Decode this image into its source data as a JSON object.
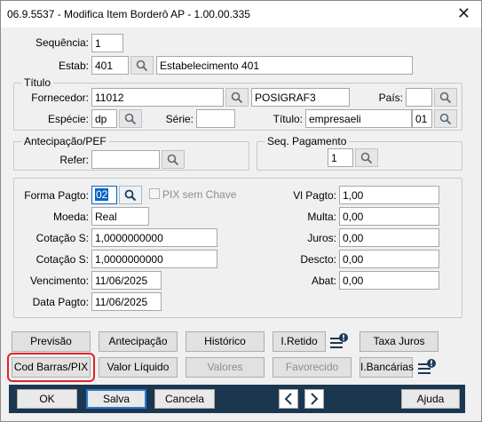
{
  "window": {
    "title": "06.9.5537 - Modifica Item Borderô AP - 1.00.00.335"
  },
  "header": {
    "sequencia_label": "Sequência:",
    "sequencia_value": "1",
    "estab_label": "Estab:",
    "estab_value": "401",
    "estab_desc": "Estabelecimento 401"
  },
  "titulo": {
    "group_label": "Título",
    "fornecedor_label": "Fornecedor:",
    "fornecedor_value": "11012",
    "fornecedor_name": "POSIGRAF3",
    "pais_label": "País:",
    "pais_value": "",
    "especie_label": "Espécie:",
    "especie_value": "dp",
    "serie_label": "Série:",
    "serie_value": "",
    "titulo_label": "Título:",
    "titulo_value": "empresaeli",
    "parcela_value": "01"
  },
  "antecipacao": {
    "group_label": "Antecipação/PEF",
    "refer_label": "Refer:",
    "refer_value": ""
  },
  "seq_pagamento": {
    "group_label": "Seq. Pagamento",
    "value": "1"
  },
  "pagamento": {
    "forma_pagto_label": "Forma Pagto:",
    "forma_pagto_value": "02",
    "pix_label": "PIX sem Chave",
    "moeda_label": "Moeda:",
    "moeda_value": "Real",
    "cotacao1_label": "Cotação S:",
    "cotacao1_value": "1,0000000000",
    "cotacao2_label": "Cotação S:",
    "cotacao2_value": "1,0000000000",
    "vencimento_label": "Vencimento:",
    "vencimento_value": "11/06/2025",
    "data_pagto_label": "Data Pagto:",
    "data_pagto_value": "11/06/2025",
    "vl_pagto_label": "Vl Pagto:",
    "vl_pagto_value": "1,00",
    "multa_label": "Multa:",
    "multa_value": "0,00",
    "juros_label": "Juros:",
    "juros_value": "0,00",
    "descto_label": "Descto:",
    "descto_value": "0,00",
    "abat_label": "Abat:",
    "abat_value": "0,00"
  },
  "actions": {
    "previsao": "Previsão",
    "antecipacao": "Antecipação",
    "historico": "Histórico",
    "i_retido": "I.Retido",
    "taxa_juros": "Taxa Juros",
    "cod_barras_pix": "Cod Barras/PIX",
    "valor_liquido": "Valor Líquido",
    "valores": "Valores",
    "favorecido": "Favorecido",
    "i_bancarias": "I.Bancárias"
  },
  "footer": {
    "ok": "OK",
    "salva": "Salva",
    "cancela": "Cancela",
    "ajuda": "Ajuda"
  },
  "colors": {
    "footer_bg": "#1b3750",
    "highlight": "#e0242a",
    "focus": "#0a63c6"
  }
}
